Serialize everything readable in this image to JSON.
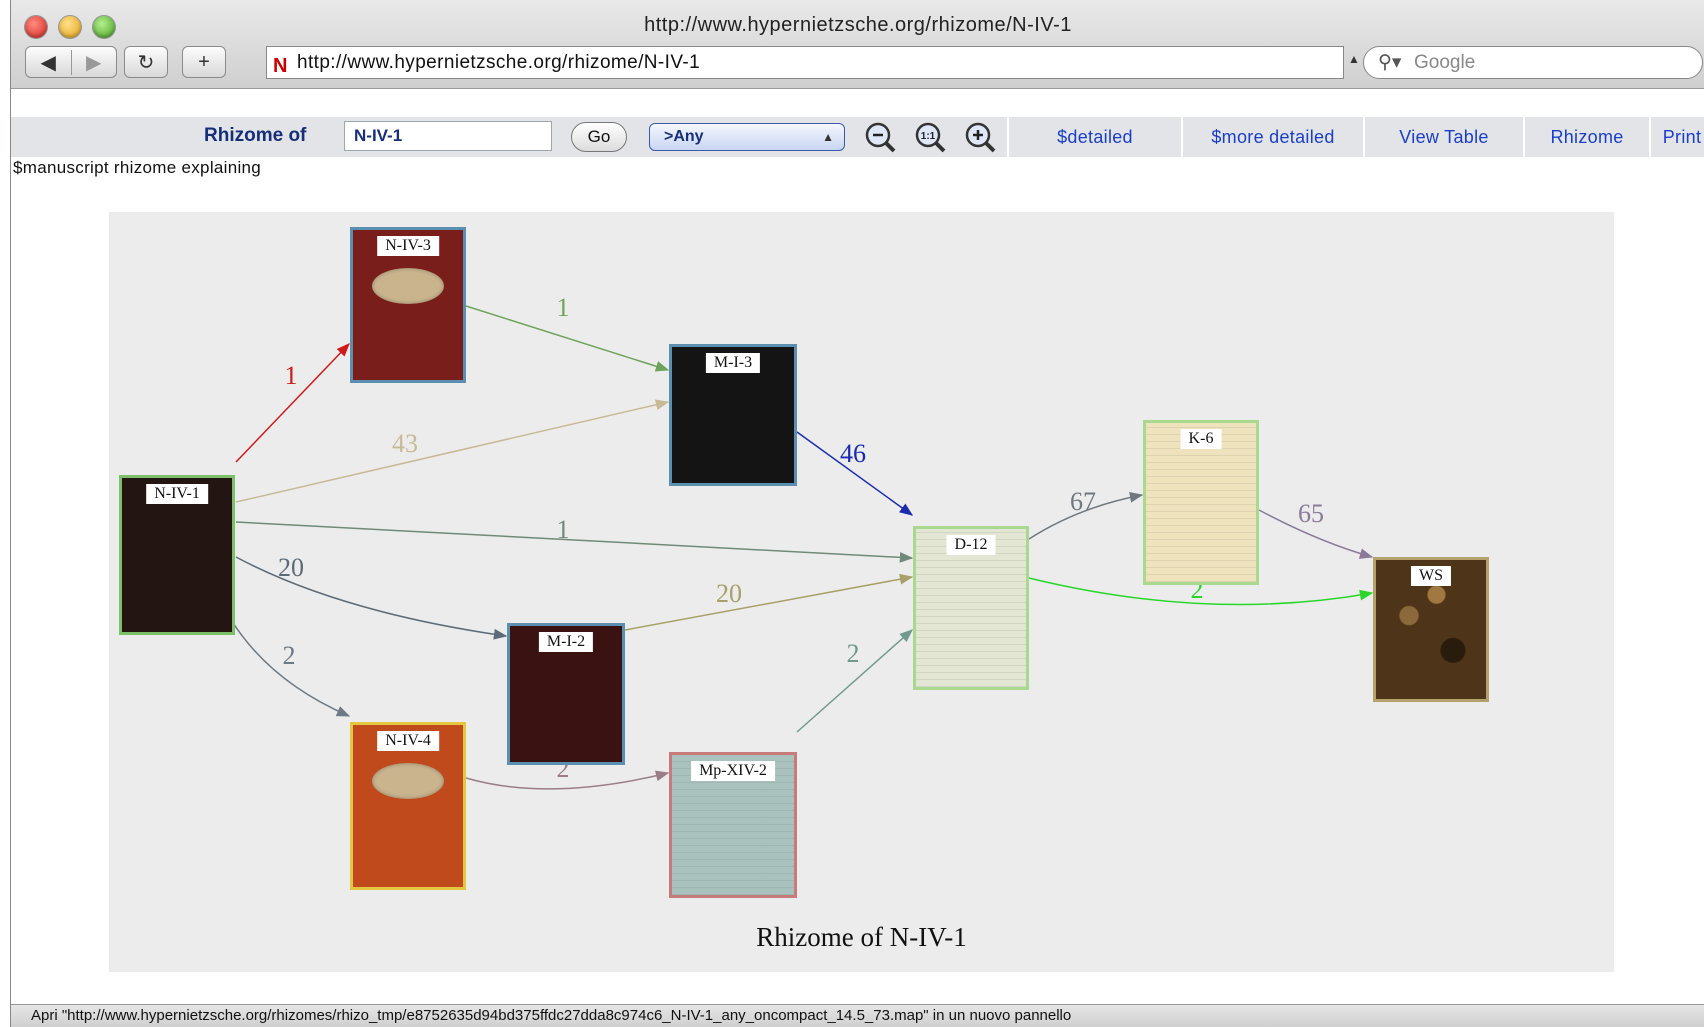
{
  "window": {
    "title": "http://www.hypernietzsche.org/rhizome/N-IV-1"
  },
  "browser": {
    "url": "http://www.hypernietzsche.org/rhizome/N-IV-1",
    "search_placeholder": "Google"
  },
  "toolbar": {
    "rhizome_label": "Rhizome of",
    "manuscript_value": "N-IV-1",
    "go_label": "Go",
    "filter_value": ">Any",
    "links": [
      "$detailed",
      "$more detailed",
      "View Table",
      "Rhizome",
      "Print"
    ]
  },
  "explanation": "$manuscript rhizome explaining",
  "graph": {
    "title": "Rhizome of N-IV-1",
    "nodes": [
      {
        "id": "N-IV-1",
        "label": "N-IV-1",
        "cover": "#231512",
        "frame": "#7dbf6a"
      },
      {
        "id": "N-IV-3",
        "label": "N-IV-3",
        "cover": "#7a1e1c",
        "frame": "#5a8fb0"
      },
      {
        "id": "M-I-3",
        "label": "M-I-3",
        "cover": "#141414",
        "frame": "#5a8fb0"
      },
      {
        "id": "M-I-2",
        "label": "M-I-2",
        "cover": "#3b1212",
        "frame": "#5a8fb0"
      },
      {
        "id": "N-IV-4",
        "label": "N-IV-4",
        "cover": "#c04a1c",
        "frame": "#e4c640"
      },
      {
        "id": "Mp-XIV-2",
        "label": "Mp-XIV-2",
        "cover": "#a9c2bd",
        "frame": "#c87b7b"
      },
      {
        "id": "D-12",
        "label": "D-12",
        "cover": "#e3e6d2",
        "frame": "#a9d98e"
      },
      {
        "id": "K-6",
        "label": "K-6",
        "cover": "#efe3be",
        "frame": "#a9d98e"
      },
      {
        "id": "WS",
        "label": "WS",
        "cover": "#4e3418",
        "frame": "#b3a06a"
      }
    ],
    "edges": [
      {
        "from": "N-IV-1",
        "to": "N-IV-3",
        "label": "1",
        "color": "#d01a1a"
      },
      {
        "from": "N-IV-3",
        "to": "M-I-3",
        "label": "1",
        "color": "#6ea35c"
      },
      {
        "from": "N-IV-1",
        "to": "M-I-3",
        "label": "43",
        "color": "#c9b997"
      },
      {
        "from": "M-I-3",
        "to": "D-12",
        "label": "46",
        "color": "#1a2bb0"
      },
      {
        "from": "N-IV-1",
        "to": "D-12",
        "label": "1",
        "color": "#6f8a78"
      },
      {
        "from": "N-IV-1",
        "to": "M-I-2",
        "label": "20",
        "color": "#5c6b78"
      },
      {
        "from": "M-I-2",
        "to": "D-12",
        "label": "20",
        "color": "#a8a068"
      },
      {
        "from": "N-IV-1",
        "to": "N-IV-4",
        "label": "2",
        "color": "#6d7a85"
      },
      {
        "from": "N-IV-4",
        "to": "Mp-XIV-2",
        "label": "2",
        "color": "#9a7d86"
      },
      {
        "from": "Mp-XIV-2",
        "to": "D-12",
        "label": "2",
        "color": "#6f9a8d"
      },
      {
        "from": "D-12",
        "to": "K-6",
        "label": "67",
        "color": "#6f7880"
      },
      {
        "from": "K-6",
        "to": "WS",
        "label": "65",
        "color": "#8c7a9a"
      },
      {
        "from": "D-12",
        "to": "WS",
        "label": "2",
        "color": "#2bd62b"
      }
    ]
  },
  "statusbar": "Apri \"http://www.hypernietzsche.org/rhizomes/rhizo_tmp/e8752635d94bd375ffdc27dda8c974c6_N-IV-1_any_oncompact_14.5_73.map\" in un nuovo pannello"
}
